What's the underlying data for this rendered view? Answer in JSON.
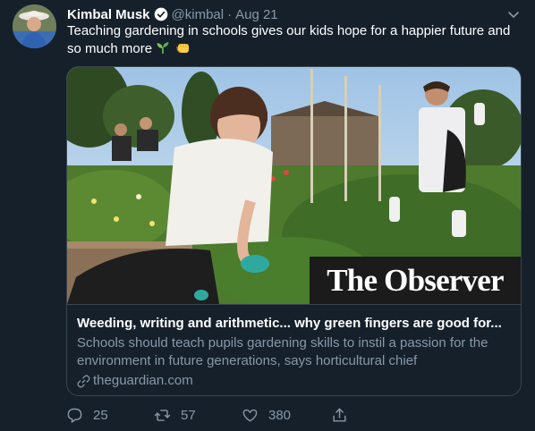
{
  "tweet": {
    "author_name": "Kimbal Musk",
    "handle": "@kimbal",
    "separator": "·",
    "date": "Aug 21",
    "text": "Teaching gardening in schools gives our kids hope for a happier future and so much more",
    "emojis": [
      "seedling-icon",
      "fist-bump-icon"
    ]
  },
  "card": {
    "publication": "The Observer",
    "title": "Weeding, writing and arithmetic... why green fingers are good for...",
    "description": "Schools should teach pupils gardening skills to instil a passion for the environment in future generations, says horticultural chief",
    "domain": "theguardian.com"
  },
  "actions": {
    "replies": "25",
    "retweets": "57",
    "likes": "380"
  },
  "colors": {
    "background": "#15202b",
    "text_primary": "#ffffff",
    "text_secondary": "#8899a6",
    "border": "#38444d",
    "verified": "#1da1f2"
  }
}
